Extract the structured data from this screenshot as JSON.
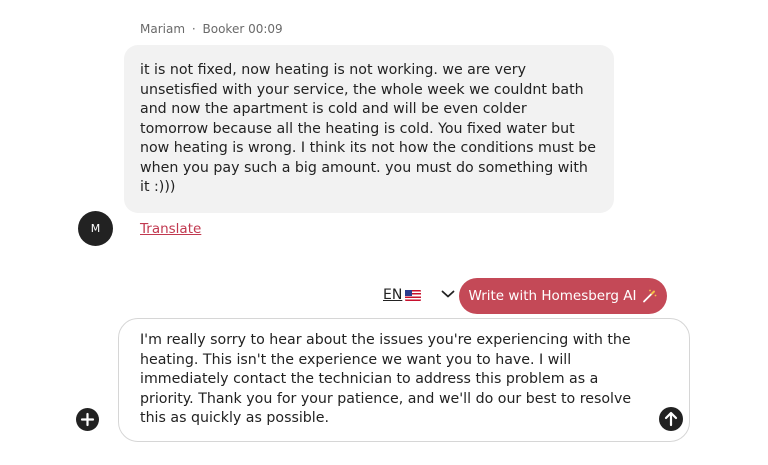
{
  "message": {
    "sender_name": "Mariam",
    "sender_role": "Booker",
    "separator": "·",
    "time": "00:09",
    "text": "it is not fixed, now heating is not working. we are very\nunsetisfied with your service, the whole week we couldnt bath\nand now the apartment is cold and will be even colder\ntomorrow because all the heating is cold. You fixed water but\nnow heating is wrong. I think its not how the conditions must be\nwhen you pay such a big amount. you must do something with\nit :)))",
    "avatar_initial": "M",
    "translate_label": "Translate"
  },
  "toolbar": {
    "language_code": "EN",
    "flag_icon": "us-flag-icon",
    "ai_button_label": "Write with Homesberg AI",
    "ai_icon": "magic-wand-icon"
  },
  "composer": {
    "text": "I'm really sorry to hear about the issues you're experiencing with the\nheating. This isn't the experience we want you to have. I will\nimmediately contact the technician to address this problem as a\npriority. Thank you for your patience, and we'll do our best to resolve\nthis as quickly as possible.",
    "add_icon": "plus-circle-icon",
    "send_icon": "arrow-up-icon"
  },
  "colors": {
    "accent": "#c44957",
    "link": "#c1384f",
    "bubble_bg": "#f2f2f2",
    "dark": "#222222"
  }
}
